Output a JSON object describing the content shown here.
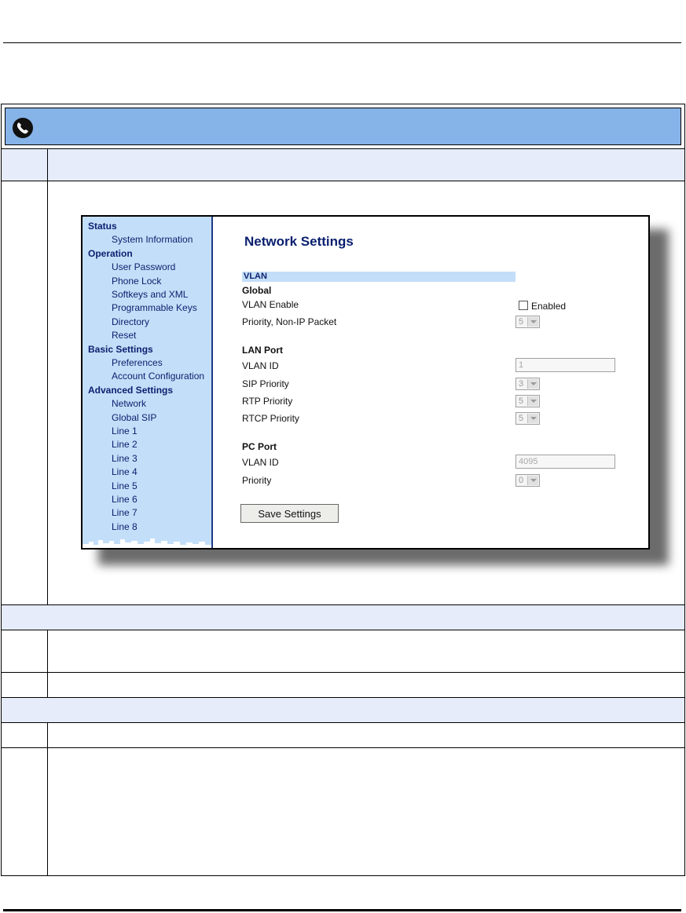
{
  "screenshot": {
    "title": "Network Settings",
    "sidebar": [
      {
        "label": "Status",
        "type": "section"
      },
      {
        "label": "System Information",
        "type": "link"
      },
      {
        "label": "Operation",
        "type": "section"
      },
      {
        "label": "User Password",
        "type": "link"
      },
      {
        "label": "Phone Lock",
        "type": "link"
      },
      {
        "label": "Softkeys and XML",
        "type": "link"
      },
      {
        "label": "Programmable Keys",
        "type": "link"
      },
      {
        "label": "Directory",
        "type": "link"
      },
      {
        "label": "Reset",
        "type": "link"
      },
      {
        "label": "Basic Settings",
        "type": "section"
      },
      {
        "label": "Preferences",
        "type": "link"
      },
      {
        "label": "Account Configuration",
        "type": "link"
      },
      {
        "label": "Advanced Settings",
        "type": "section"
      },
      {
        "label": "Network",
        "type": "link"
      },
      {
        "label": "Global SIP",
        "type": "link"
      },
      {
        "label": "Line 1",
        "type": "link"
      },
      {
        "label": "Line 2",
        "type": "link"
      },
      {
        "label": "Line 3",
        "type": "link"
      },
      {
        "label": "Line 4",
        "type": "link"
      },
      {
        "label": "Line 5",
        "type": "link"
      },
      {
        "label": "Line 6",
        "type": "link"
      },
      {
        "label": "Line 7",
        "type": "link"
      },
      {
        "label": "Line 8",
        "type": "link"
      }
    ],
    "vlan_section": "VLAN",
    "global": {
      "heading": "Global",
      "vlan_enable_label": "VLAN Enable",
      "vlan_enable_checkbox_label": "Enabled",
      "vlan_enable_checked": false,
      "priority_non_ip_label": "Priority, Non-IP Packet",
      "priority_non_ip_value": "5"
    },
    "lan_port": {
      "heading": "LAN Port",
      "vlan_id_label": "VLAN ID",
      "vlan_id_value": "1",
      "sip_priority_label": "SIP Priority",
      "sip_priority_value": "3",
      "rtp_priority_label": "RTP Priority",
      "rtp_priority_value": "5",
      "rtcp_priority_label": "RTCP Priority",
      "rtcp_priority_value": "5"
    },
    "pc_port": {
      "heading": "PC Port",
      "vlan_id_label": "VLAN ID",
      "vlan_id_value": "4095",
      "priority_label": "Priority",
      "priority_value": "0"
    },
    "save_button": "Save Settings"
  },
  "colors": {
    "banner": "#86b3e8",
    "header_row": "#e6ecfa",
    "sidebar": "#c3def8",
    "link_text": "#0a1f6e"
  }
}
